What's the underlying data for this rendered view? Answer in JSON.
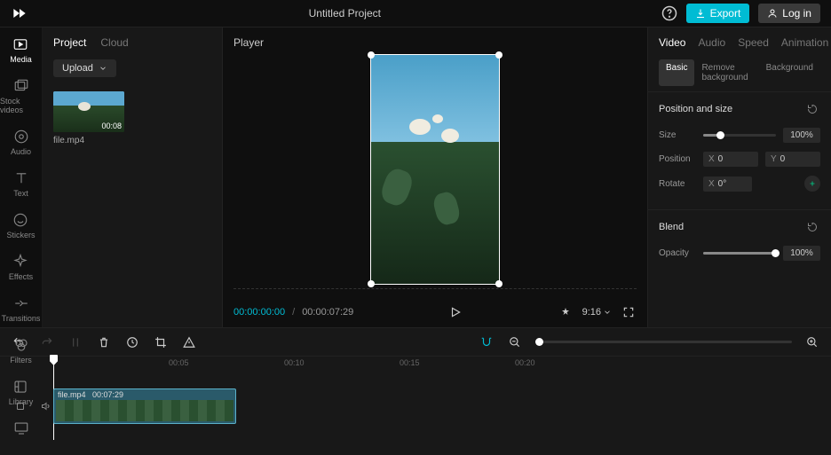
{
  "header": {
    "title": "Untitled Project",
    "export_label": "Export",
    "login_label": "Log in"
  },
  "rail": {
    "items": [
      {
        "label": "Media",
        "icon": "media-icon"
      },
      {
        "label": "Stock videos",
        "icon": "stock-icon"
      },
      {
        "label": "Audio",
        "icon": "audio-icon"
      },
      {
        "label": "Text",
        "icon": "text-icon"
      },
      {
        "label": "Stickers",
        "icon": "stickers-icon"
      },
      {
        "label": "Effects",
        "icon": "effects-icon"
      },
      {
        "label": "Transitions",
        "icon": "transitions-icon"
      },
      {
        "label": "Filters",
        "icon": "filters-icon"
      },
      {
        "label": "Library",
        "icon": "library-icon"
      }
    ]
  },
  "media": {
    "tabs": {
      "project": "Project",
      "cloud": "Cloud"
    },
    "upload_label": "Upload",
    "item": {
      "name": "file.mp4",
      "duration": "00:08"
    }
  },
  "player": {
    "title": "Player",
    "current_time": "00:00:00:00",
    "total_time": "00:00:07:29",
    "ratio": "9:16"
  },
  "props": {
    "tabs": {
      "video": "Video",
      "audio": "Audio",
      "speed": "Speed",
      "animation": "Animation"
    },
    "subtabs": {
      "basic": "Basic",
      "remove_bg": "Remove background",
      "background": "Background"
    },
    "position_size": {
      "title": "Position and size",
      "size_label": "Size",
      "size_value": "100%",
      "position_label": "Position",
      "x_label": "X",
      "x_value": "0",
      "y_label": "Y",
      "y_value": "0",
      "rotate_label": "Rotate",
      "rotate_x_label": "X",
      "rotate_value": "0°"
    },
    "blend": {
      "title": "Blend",
      "opacity_label": "Opacity",
      "opacity_value": "100%"
    }
  },
  "timeline": {
    "ticks": [
      "00:05",
      "00:10",
      "00:15",
      "00:20"
    ],
    "clip": {
      "name": "file.mp4",
      "duration": "00:07:29"
    }
  }
}
